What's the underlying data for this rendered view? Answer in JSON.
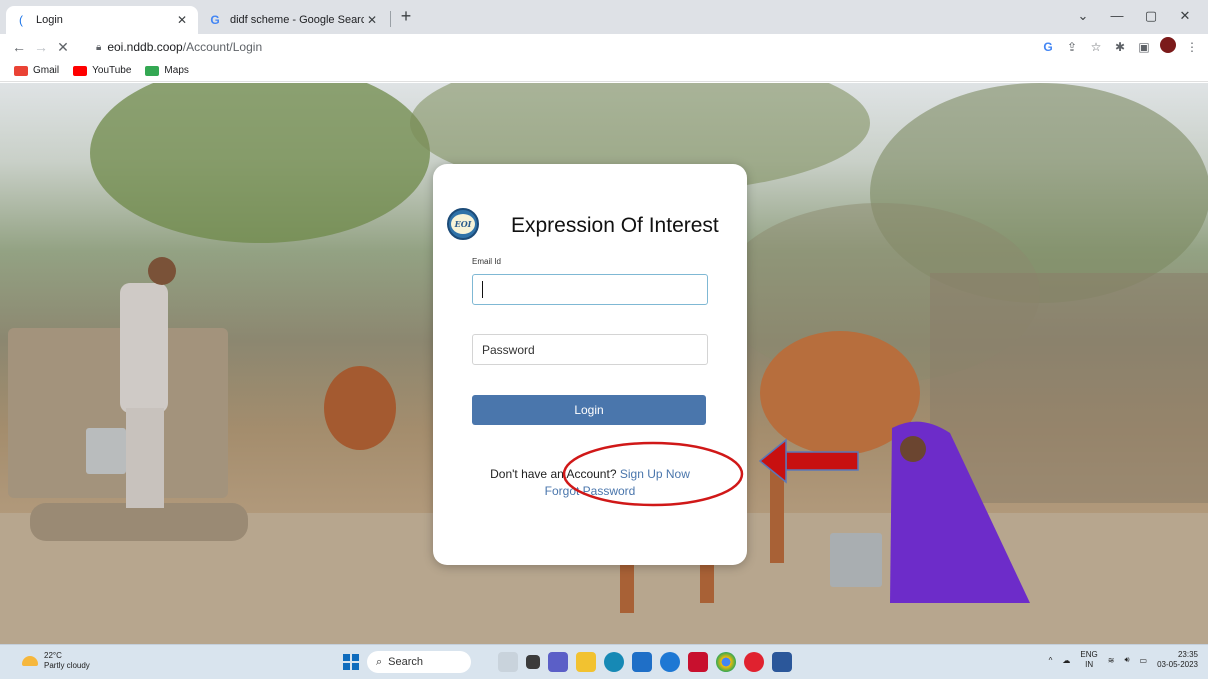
{
  "browser": {
    "tabs": [
      {
        "title": "Login",
        "active": true
      },
      {
        "title": "didf scheme - Google Search",
        "active": false
      }
    ],
    "url_domain": "eoi.nddb.coop",
    "url_path": "/Account/Login",
    "bookmarks": [
      {
        "label": "Gmail",
        "color": "#ea4335"
      },
      {
        "label": "YouTube",
        "color": "#ff0000"
      },
      {
        "label": "Maps",
        "color": "#34a853"
      }
    ]
  },
  "login_card": {
    "logo_text": "EOI",
    "title": "Expression Of Interest",
    "email_label": "Email Id",
    "email_value": "",
    "password_placeholder": "Password",
    "login_button": "Login",
    "signup_prompt": "Don't have an Account?",
    "signup_link": "Sign Up Now",
    "forgot_link": "Forgot Password"
  },
  "annotation": {
    "color": "#d01818"
  },
  "taskbar": {
    "weather_temp": "22°C",
    "weather_desc": "Partly cloudy",
    "search_label": "Search",
    "lang_top": "ENG",
    "lang_bottom": "IN",
    "time": "23:35",
    "date": "03-05-2023"
  }
}
